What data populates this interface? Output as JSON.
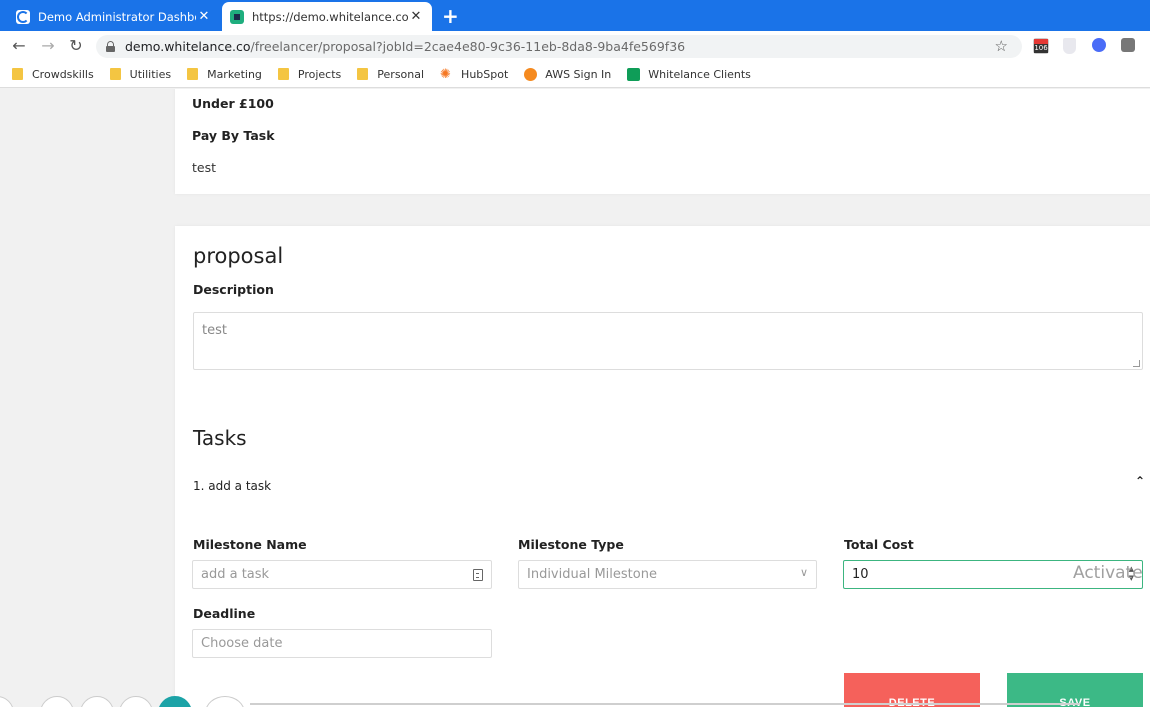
{
  "browser": {
    "tabs": [
      {
        "title": "Demo Administrator Dashboard",
        "active": false
      },
      {
        "title": "https://demo.whitelance.co/freel",
        "active": true
      }
    ],
    "url_host": "demo.whitelance.co",
    "url_path": "/freelancer/proposal?jobId=2cae4e80-9c36-11eb-8da8-9ba4fe569f36",
    "calendar_badge": "106",
    "bookmarks": [
      {
        "label": "Crowdskills",
        "icon": "folder-icon"
      },
      {
        "label": "Utilities",
        "icon": "folder-icon"
      },
      {
        "label": "Marketing",
        "icon": "folder-icon"
      },
      {
        "label": "Projects",
        "icon": "folder-icon"
      },
      {
        "label": "Personal",
        "icon": "folder-icon"
      },
      {
        "label": "HubSpot",
        "icon": "hubspot-icon"
      },
      {
        "label": "AWS Sign In",
        "icon": "aws-icon"
      },
      {
        "label": "Whitelance Clients",
        "icon": "sheets-icon"
      }
    ]
  },
  "job": {
    "budget": "Under £100",
    "pay_type": "Pay By Task",
    "note": "test"
  },
  "proposal": {
    "heading": "proposal",
    "description_label": "Description",
    "description_value": "test"
  },
  "tasks": {
    "heading": "Tasks",
    "item_title": "1. add a task",
    "milestone_name_label": "Milestone Name",
    "milestone_name_placeholder": "add a task",
    "milestone_type_label": "Milestone Type",
    "milestone_type_value": "Individual Milestone",
    "total_cost_label": "Total Cost",
    "total_cost_value": "10",
    "deadline_label": "Deadline",
    "deadline_placeholder": "Choose date",
    "delete_label": "DELETE",
    "save_label": "SAVE"
  },
  "overlay": {
    "watermark": "Activate"
  },
  "colors": {
    "chrome_blue": "#1a73e8",
    "delete_red": "#f5615b",
    "save_green": "#3cb986",
    "focus_green": "#3cb580"
  }
}
